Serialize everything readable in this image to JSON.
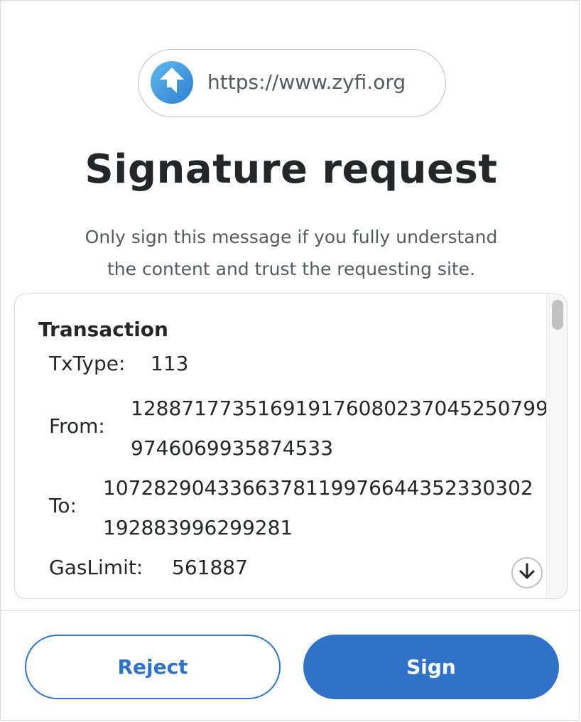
{
  "header": {
    "origin_url": "https://www.zyfi.org",
    "site_icon": "arrow-up-logo-icon"
  },
  "title": "Signature request",
  "subtitle_line1": "Only sign this message if you fully understand",
  "subtitle_line2": "the content and trust the requesting site.",
  "message": {
    "section": "Transaction",
    "fields": [
      {
        "label": "TxType:",
        "value": "113"
      },
      {
        "label": "From:",
        "value_line1": "12887177351691917608023704525079​9",
        "value_line2": "9746069935874533"
      },
      {
        "label": "To:",
        "value_line1": "107282904336637811997664435233030​2",
        "value_line2": "192883996299281"
      },
      {
        "label": "GasLimit:",
        "value": "561887"
      }
    ],
    "scroll_icon": "arrow-down-icon"
  },
  "footer": {
    "reject_label": "Reject",
    "sign_label": "Sign"
  },
  "colors": {
    "primary": "#2f72c7",
    "text": "#24272a",
    "muted": "#535a61",
    "border": "#d6d9dc"
  }
}
